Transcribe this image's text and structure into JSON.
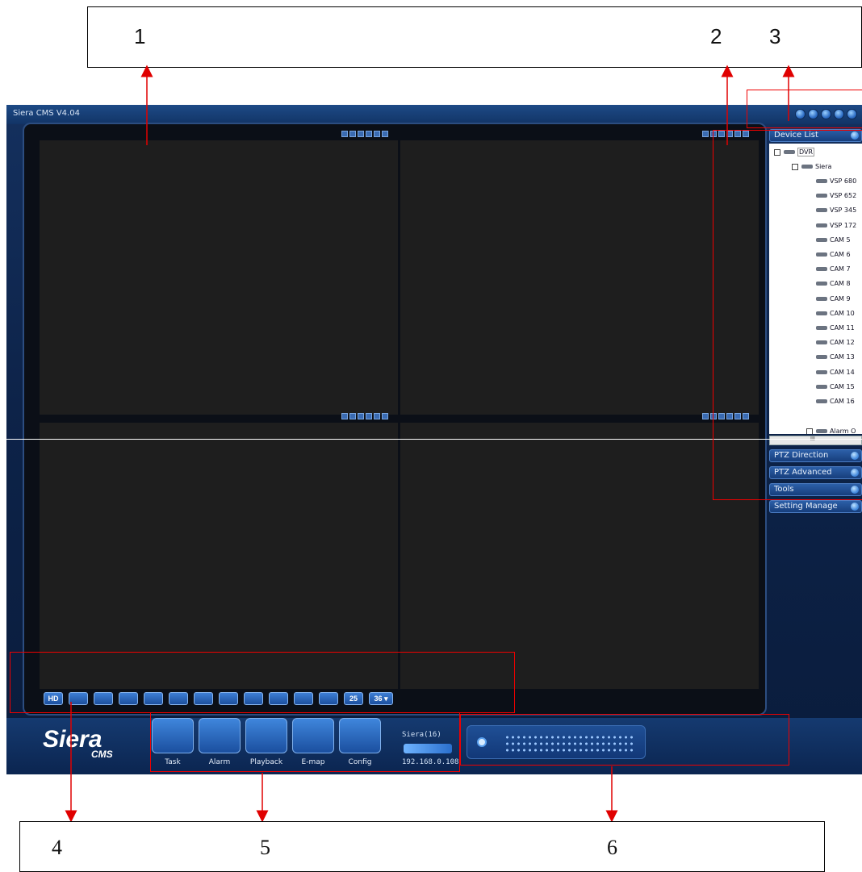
{
  "window": {
    "title": "Siera CMS  V4.04"
  },
  "callouts": {
    "top": [
      "1",
      "2",
      "3"
    ],
    "bottom": [
      "4",
      "5",
      "6"
    ]
  },
  "video": {
    "panes": 4
  },
  "layout_bar": {
    "buttons": [
      "HD",
      "",
      "",
      "",
      "",
      "",
      "",
      "",
      "",
      "",
      "",
      "",
      "25",
      "36 ▾"
    ]
  },
  "side_panel": {
    "device_list_title": "Device List",
    "tree": {
      "root": "DVR",
      "site": "Siera",
      "cameras": [
        "VSP 680",
        "VSP 652",
        "VSP 345",
        "VSP 172",
        "CAM 5",
        "CAM 6",
        "CAM 7",
        "CAM 8",
        "CAM 9",
        "CAM 10",
        "CAM 11",
        "CAM 12",
        "CAM 13",
        "CAM 14",
        "CAM 15",
        "CAM 16"
      ],
      "alarm": "Alarm O"
    },
    "sections": [
      "PTZ Direction",
      "PTZ Advanced",
      "Tools",
      "Setting Manage"
    ],
    "scroll_label": "III"
  },
  "bottom_bar": {
    "logo_main": "Siera",
    "logo_sub": "CMS",
    "tools": [
      "Task",
      "Alarm",
      "Playback",
      "E-map",
      "Config"
    ],
    "dvr_name": "Siera(16)",
    "dvr_ip": "192.168.0.108"
  },
  "colors": {
    "accent": "#3f86dc",
    "annotation": "#e00000"
  }
}
